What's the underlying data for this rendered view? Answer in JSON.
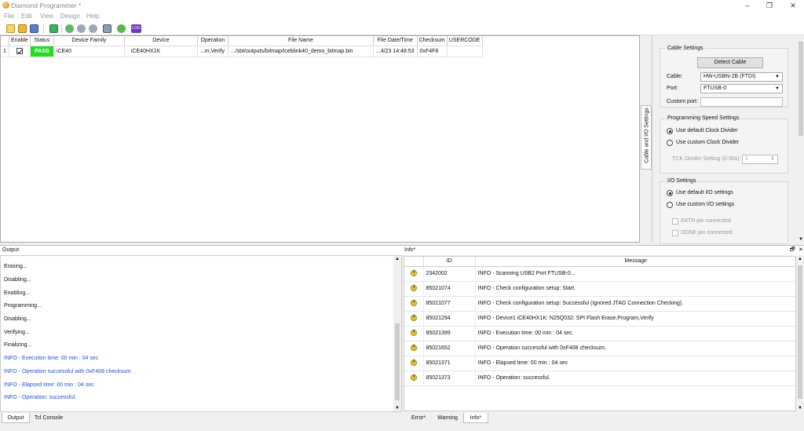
{
  "window": {
    "title": "Diamond Programmer *",
    "minimize": "–",
    "restore": "❐",
    "close": "✕"
  },
  "menu": [
    "File",
    "Edit",
    "View",
    "Design",
    "Help"
  ],
  "toolbar": {
    "icons": [
      "new-icon",
      "open-icon",
      "save-icon",
      "scan-icon",
      "program-icon",
      "program-icon",
      "program-icon",
      "chip-icon",
      "download-icon",
      "log-icon"
    ],
    "log_label": "LOG"
  },
  "grid": {
    "headers": [
      "",
      "Enable",
      "Status",
      "Device Family",
      "Device",
      "Operation",
      "File Name",
      "File Date/Time",
      "Checksum",
      "USERCODE"
    ],
    "rows": [
      {
        "index": "1",
        "enabled": true,
        "status": "PASS",
        "family": "iCE40",
        "device": "iCE40HX1K",
        "operation": "...m,Verify",
        "file": ".../sbt/outputs/bitmap/iceblink40_demo_bitmap.bin",
        "date": "...4/23 14:48:53",
        "checksum": "0xF4F8",
        "usercode": ""
      }
    ],
    "status_color": "#22dd22"
  },
  "sidetab": {
    "label": "Cable and I/O Settings"
  },
  "settings": {
    "cable_group": "Cable Settings",
    "detect_button": "Detect Cable",
    "cable_label": "Cable:",
    "cable_value": "HW-USBN-2B (FTDI)",
    "port_label": "Port:",
    "port_value": "FTUSB-0",
    "custom_port_label": "Custom port:",
    "custom_port_value": "",
    "speed_group": "Programming Speed Settings",
    "speed_default": "Use default Clock Divider",
    "speed_custom": "Use custom Clock Divider",
    "tck_label": "TCK Divider Setting (0-30x):",
    "tck_value": "1",
    "io_group": "I/O Settings",
    "io_default": "Use default I/O settings",
    "io_custom": "Use custom I/O settings",
    "initn": "INITN pin connected",
    "done": "DONE pin connected"
  },
  "output": {
    "title": "Output",
    "lines": [
      {
        "text": "Erasing...",
        "kind": "plain"
      },
      {
        "text": "Disabling...",
        "kind": "plain"
      },
      {
        "text": "Enabling...",
        "kind": "plain"
      },
      {
        "text": "Programming...",
        "kind": "plain"
      },
      {
        "text": "Disabling...",
        "kind": "plain"
      },
      {
        "text": "Verifying...",
        "kind": "plain"
      },
      {
        "text": "Finalizing...",
        "kind": "plain"
      },
      {
        "text": "INFO - Execution time: 00 min : 04 sec",
        "kind": "info"
      },
      {
        "text": "INFO - Operation successful with 0xF408 checksum.",
        "kind": "info"
      },
      {
        "text": "INFO - Elapsed time: 00 min : 04 sec",
        "kind": "info"
      },
      {
        "text": "INFO - Operation: successful.",
        "kind": "info"
      }
    ],
    "tabs": [
      "Output",
      "Tcl Console"
    ],
    "info_color": "#2255cc"
  },
  "info": {
    "title": "Info*",
    "pin": "🗗",
    "close": "✕",
    "headers": [
      "",
      "ID",
      "Message"
    ],
    "rows": [
      {
        "id": "2342002",
        "message": "INFO - Scanning USB2 Port FTUSB-0..."
      },
      {
        "id": "85021074",
        "message": "INFO - Check configuration setup: Start."
      },
      {
        "id": "85021077",
        "message": "INFO - Check configuration setup: Successful (Ignored JTAG Connection Checking)."
      },
      {
        "id": "85021294",
        "message": "INFO - Device1 iCE40HX1K: N25Q032: SPI Flash Erase,Program,Verify"
      },
      {
        "id": "85021399",
        "message": "INFO - Execution time: 00 min : 04 sec"
      },
      {
        "id": "85021652",
        "message": "INFO - Operation successful with 0xF408 checksum."
      },
      {
        "id": "85021371",
        "message": "INFO - Elapsed time: 00 min : 04 sec"
      },
      {
        "id": "85021373",
        "message": "INFO - Operation: successful."
      }
    ],
    "tabs": [
      "Error*",
      "Warning",
      "Info*"
    ]
  }
}
